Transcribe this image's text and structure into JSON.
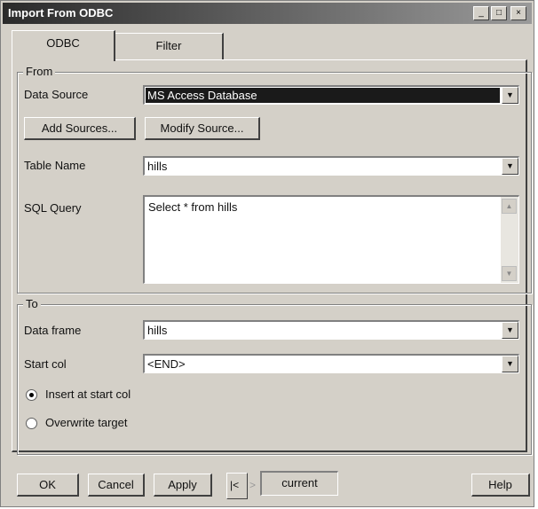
{
  "window": {
    "title": "Import From ODBC",
    "controls": {
      "minimize": "_",
      "maximize": "□",
      "close": "×"
    }
  },
  "tabs": [
    {
      "label": "ODBC",
      "active": true
    },
    {
      "label": "Filter",
      "active": false
    }
  ],
  "from": {
    "legend": "From",
    "data_source_label": "Data Source",
    "data_source_value": "MS Access Database",
    "add_sources_label": "Add Sources...",
    "modify_source_label": "Modify Source...",
    "table_name_label": "Table Name",
    "table_name_value": "hills",
    "sql_query_label": "SQL Query",
    "sql_query_value": "Select * from hills"
  },
  "to": {
    "legend": "To",
    "data_frame_label": "Data frame",
    "data_frame_value": "hills",
    "start_col_label": "Start col",
    "start_col_value": "<END>",
    "insert_label": "Insert at start col",
    "overwrite_label": "Overwrite target",
    "selected_option": "insert"
  },
  "footer": {
    "ok_label": "OK",
    "cancel_label": "Cancel",
    "apply_label": "Apply",
    "nav_first": "|<",
    "nav_next": ">",
    "current_label": "current",
    "help_label": "Help"
  }
}
